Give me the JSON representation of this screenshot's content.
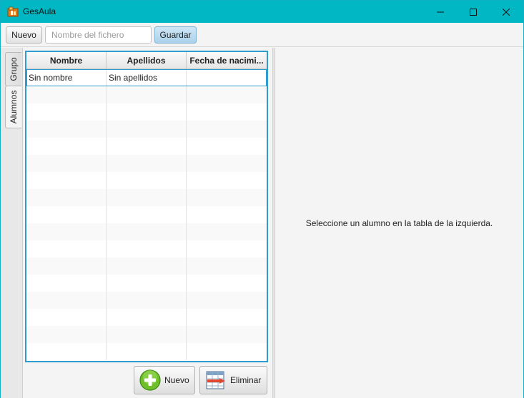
{
  "window": {
    "title": "GesAula",
    "accent": "#00b7c3"
  },
  "toolbar": {
    "new_label": "Nuevo",
    "file_placeholder": "Nombre del fichero",
    "file_value": "",
    "save_label": "Guardar"
  },
  "tabs": [
    {
      "label": "Grupo",
      "selected": false
    },
    {
      "label": "Alumnos",
      "selected": true
    }
  ],
  "table": {
    "columns": [
      "Nombre",
      "Apellidos",
      "Fecha de nacimi..."
    ],
    "rows": [
      {
        "nombre": "Sin nombre",
        "apellidos": "Sin apellidos",
        "fecha": ""
      }
    ],
    "selection_color": "#2f9cd0"
  },
  "actions": {
    "new_label": "Nuevo",
    "delete_label": "Eliminar"
  },
  "detail": {
    "message": "Seleccione un alumno en la tabla de la izquierda."
  }
}
